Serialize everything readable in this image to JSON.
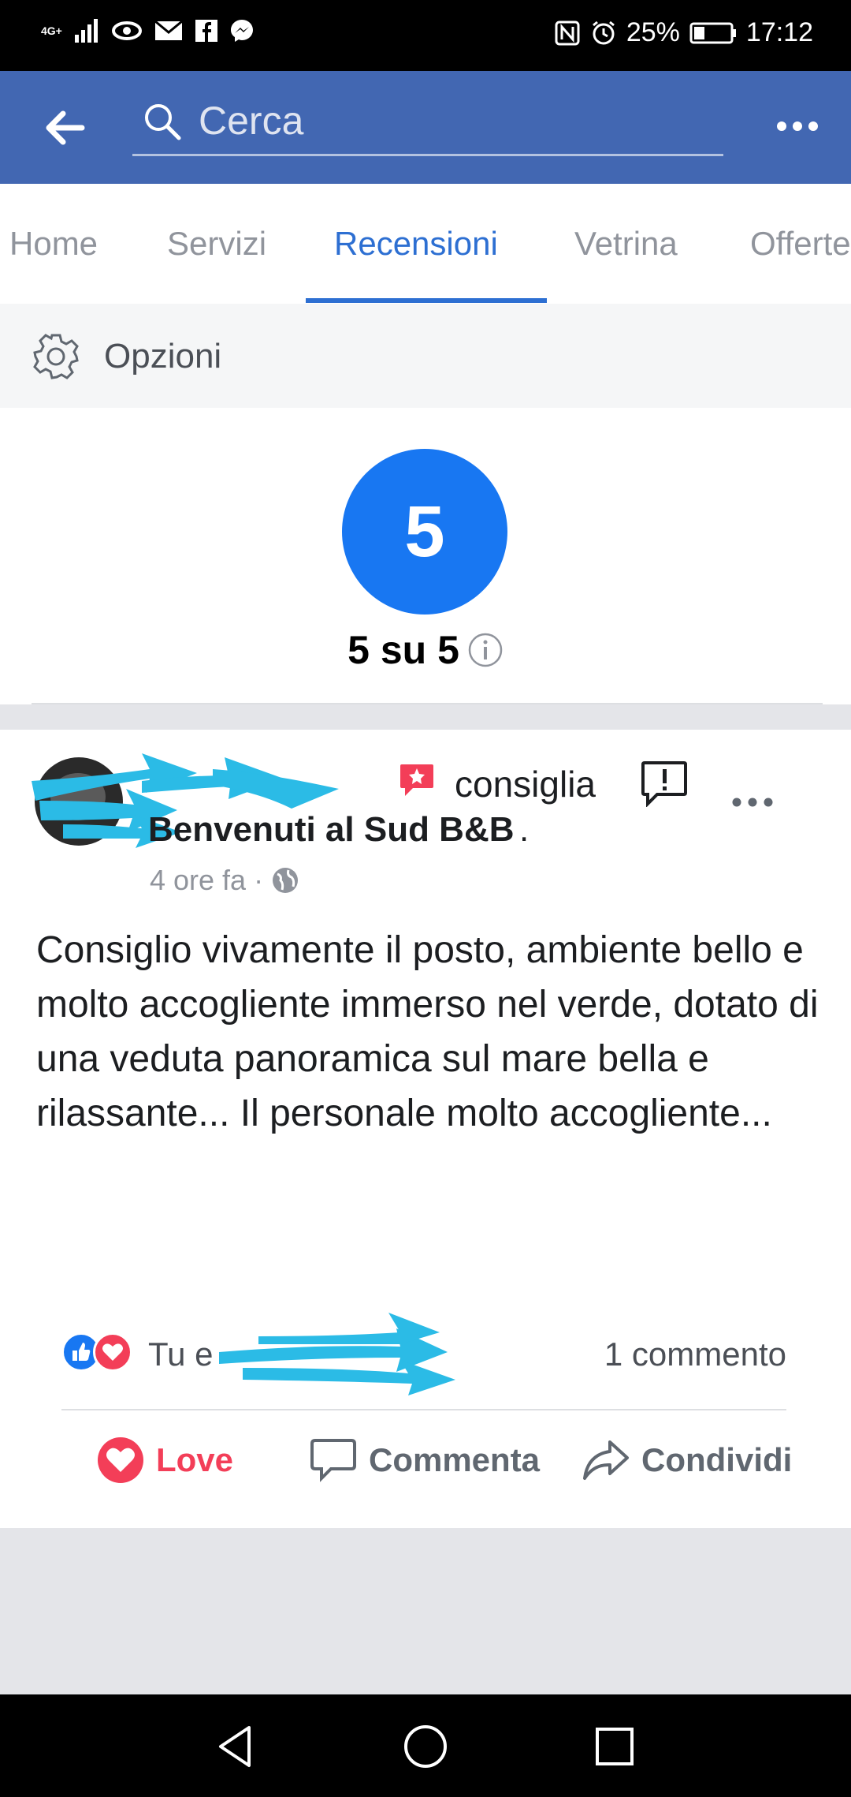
{
  "status_bar": {
    "network": "4G+",
    "battery": "25%",
    "time": "17:12"
  },
  "header": {
    "search_placeholder": "Cerca"
  },
  "tabs": [
    {
      "label": "Home"
    },
    {
      "label": "Servizi"
    },
    {
      "label": "Recensioni",
      "active": true
    },
    {
      "label": "Vetrina"
    },
    {
      "label": "Offerte"
    }
  ],
  "options": {
    "label": "Opzioni"
  },
  "rating": {
    "score": "5",
    "summary": "5 su 5"
  },
  "post": {
    "verb": "consiglia",
    "page_name": "Benvenuti al Sud B&B",
    "page_name_suffix": ".",
    "time": "4 ore fa",
    "body": "Consiglio vivamente il posto, ambiente bello e molto accogliente immerso nel verde, dotato di  una veduta panoramica sul mare bella e rilassante... Il personale molto accogliente...",
    "reactions_text": "Tu e",
    "comments_count": "1 commento",
    "actions": {
      "love": "Love",
      "comment": "Commenta",
      "share": "Condividi"
    }
  },
  "colors": {
    "brand": "#4267b2",
    "accent": "#2d6fd2",
    "love": "#f33e58",
    "scribble": "#2bbbe6"
  }
}
